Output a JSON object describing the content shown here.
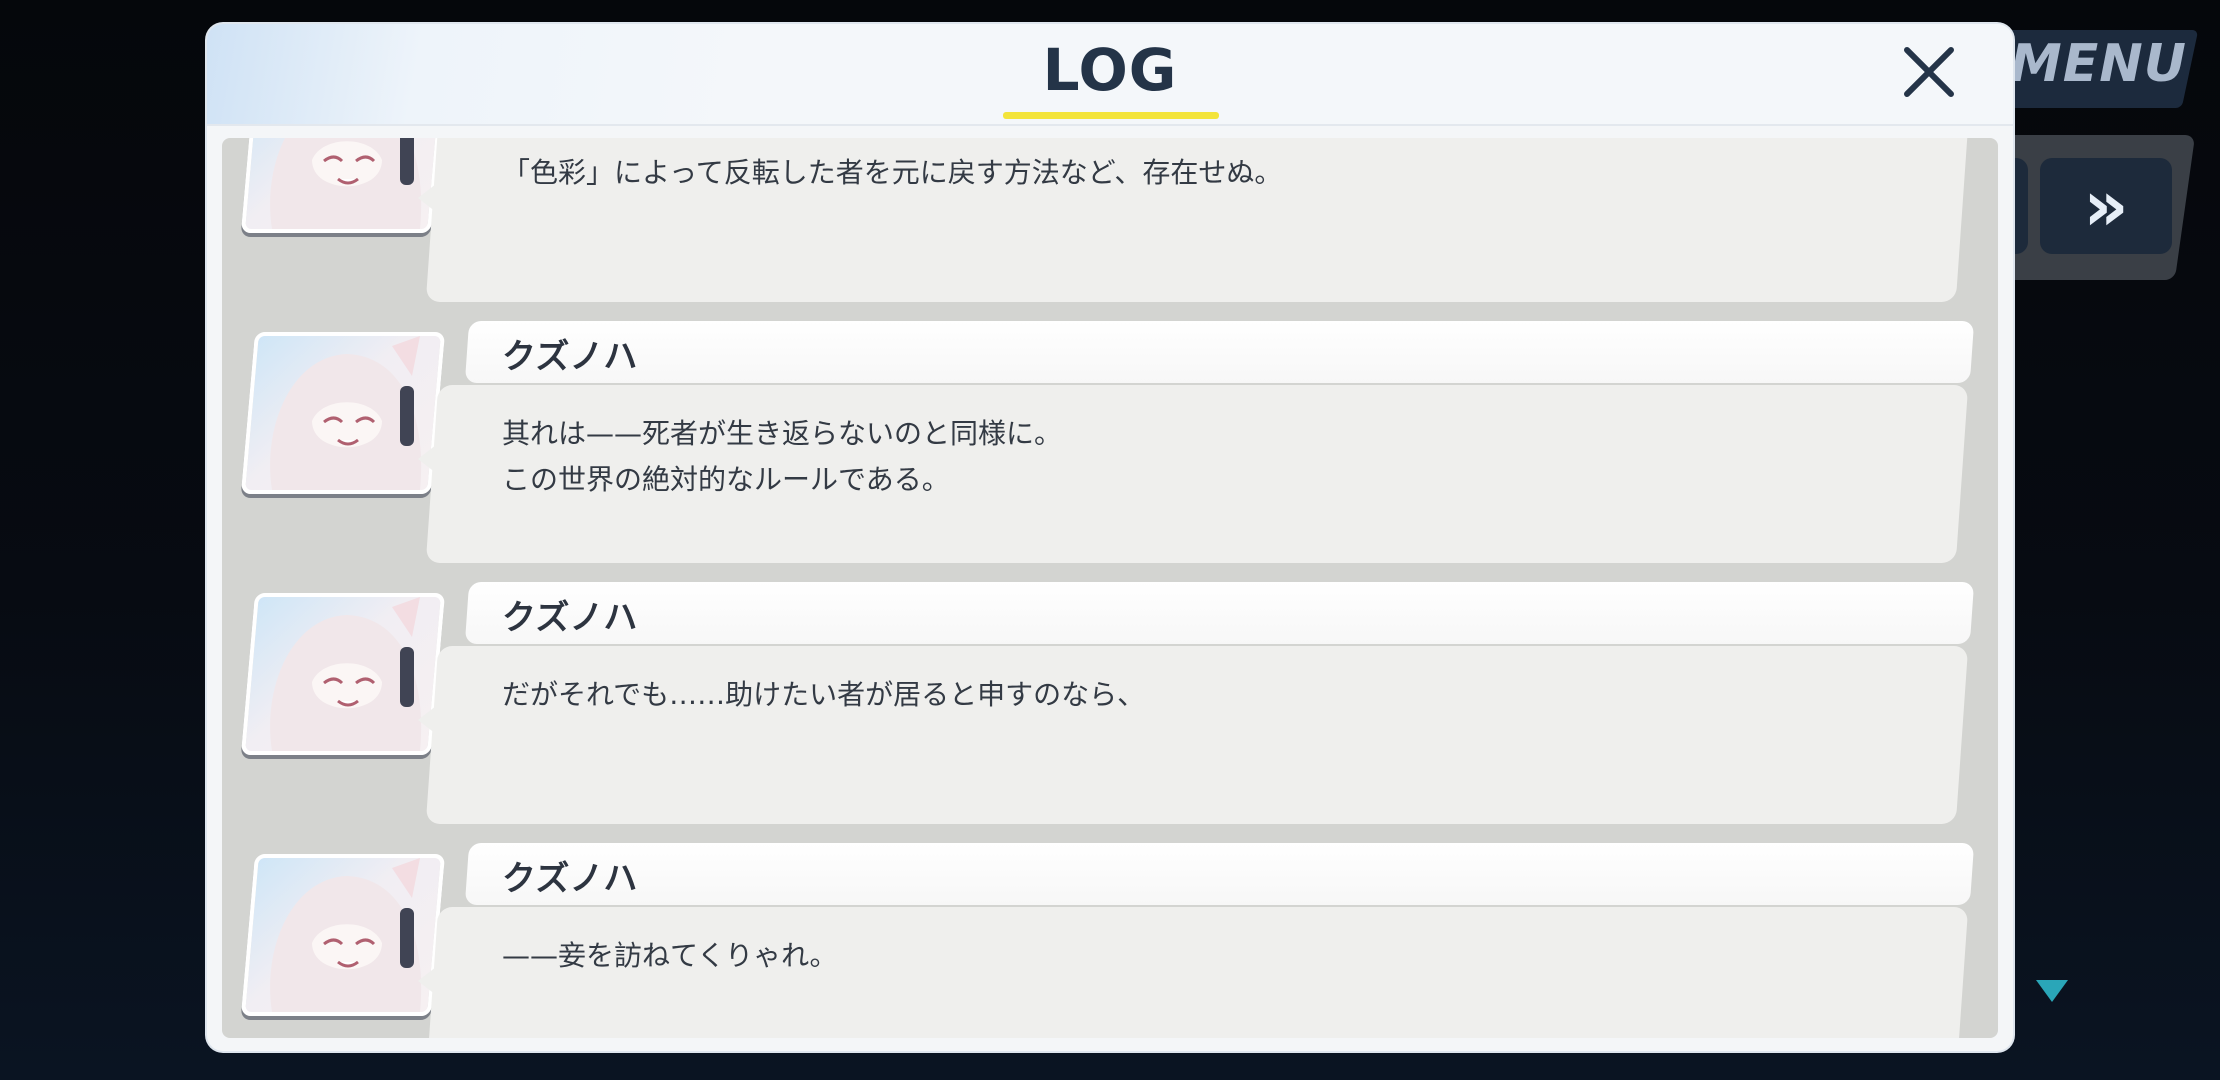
{
  "background": {
    "menu_label": "MENU",
    "fast_forward_icon": "double-chevron-right-icon",
    "scroll_down_icon": "triangle-down-icon"
  },
  "log": {
    "title": "LOG",
    "close_icon": "close-icon",
    "entries": [
      {
        "speaker": "",
        "text": "「色彩」によって反転した者を元に戻す方法など、存在せぬ。"
      },
      {
        "speaker": "クズノハ",
        "text": "其れは——死者が生き返らないのと同様に。\nこの世界の絶対的なルールである。"
      },
      {
        "speaker": "クズノハ",
        "text": "だがそれでも……助けたい者が居ると申すのなら、"
      },
      {
        "speaker": "クズノハ",
        "text": "——妾を訪ねてくりゃれ。"
      }
    ]
  },
  "colors": {
    "title": "#243448",
    "underline": "#f3e43a",
    "list_bg": "#d3d4d1",
    "bubble": "#efefed"
  }
}
